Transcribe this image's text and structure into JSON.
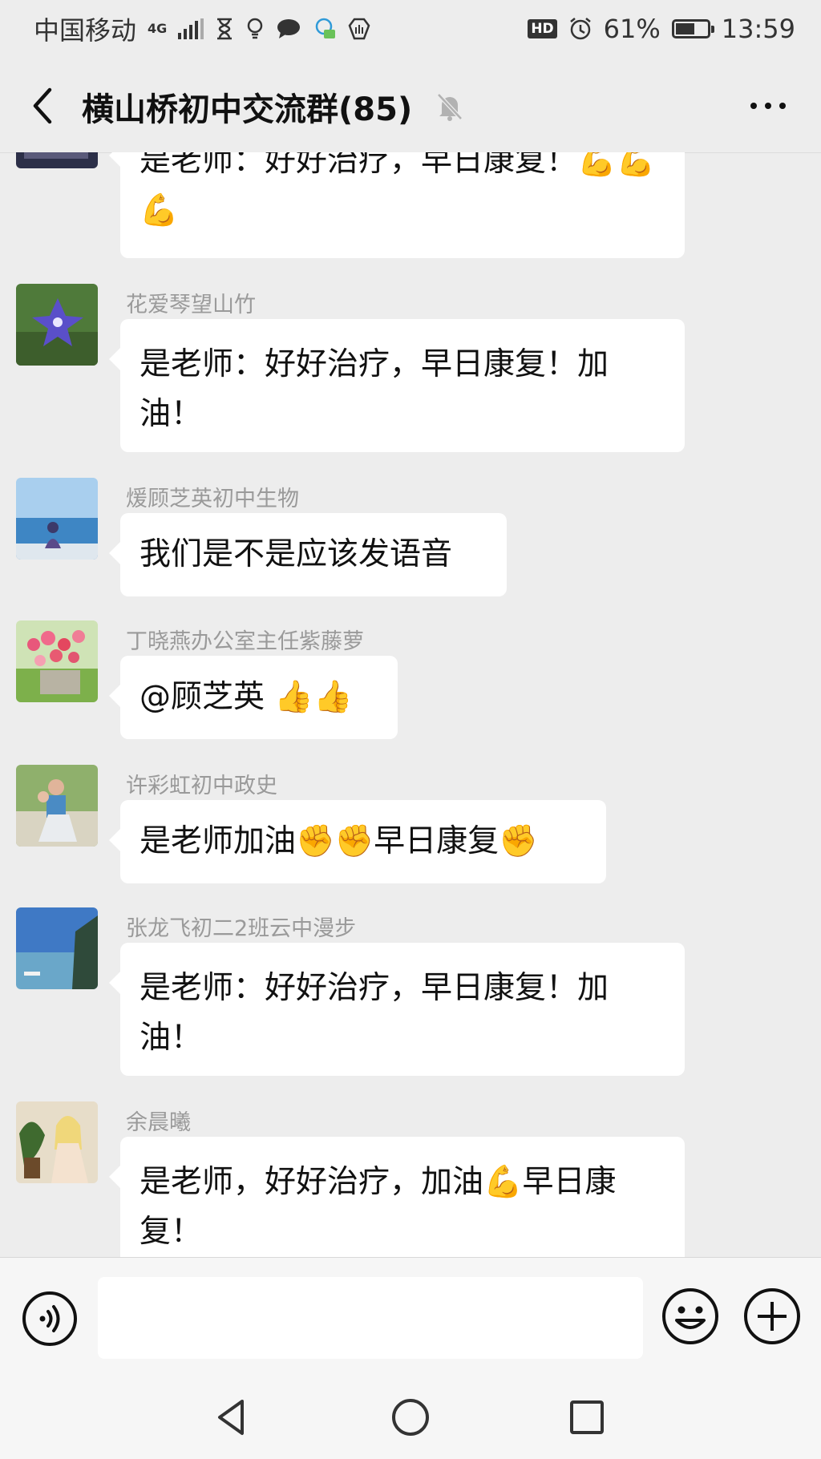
{
  "status_bar": {
    "carrier": "中国移动",
    "network": "4G",
    "hd": "HD",
    "battery": "61%",
    "battery_level": 0.61,
    "time": "13:59"
  },
  "header": {
    "title": "横山桥初中交流群(85)",
    "icons": [
      "back-arrow-icon",
      "mute-bell-icon",
      "more-icon"
    ]
  },
  "messages": [
    {
      "name": "",
      "text": "是老师：好好治疗，早日康复！💪💪💪",
      "avatar": "partial-avatar"
    },
    {
      "name": "花爱琴望山竹",
      "text": "是老师：好好治疗，早日康复！加油！",
      "avatar": "purple-flower"
    },
    {
      "name": "煖顾芝英初中生物",
      "text": "我们是不是应该发语音",
      "avatar": "person-by-sea"
    },
    {
      "name": "丁晓燕办公室主任紫藤萝",
      "text": "@顾芝英 👍👍",
      "avatar": "flower-pot"
    },
    {
      "name": "许彩虹初中政史",
      "text": "是老师加油✊✊早日康复✊",
      "avatar": "family-photo"
    },
    {
      "name": "张龙飞初二2班云中漫步",
      "text": "是老师：好好治疗，早日康复！加油！",
      "avatar": "seaside"
    },
    {
      "name": "余晨曦",
      "text": "是老师，好好治疗，加油💪早日康复！",
      "avatar": "woman-with-plant"
    }
  ],
  "input_bar": {
    "placeholder": "",
    "icons": [
      "voice-icon",
      "emoji-icon",
      "plus-icon"
    ]
  },
  "nav_bar": {
    "icons": [
      "nav-back-icon",
      "nav-home-icon",
      "nav-recent-icon"
    ]
  }
}
